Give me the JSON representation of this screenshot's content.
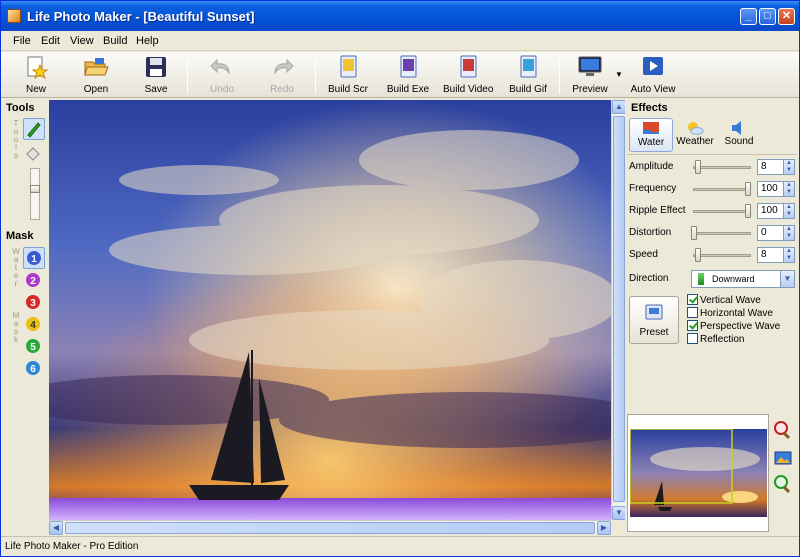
{
  "window": {
    "title": "Life Photo Maker - [Beautiful Sunset]"
  },
  "menu": [
    "File",
    "Edit",
    "View",
    "Build",
    "Help"
  ],
  "toolbar": {
    "new": "New",
    "open": "Open",
    "save": "Save",
    "undo": "Undo",
    "redo": "Redo",
    "build_scr": "Build Scr",
    "build_exe": "Build Exe",
    "build_video": "Build Video",
    "build_gif": "Build Gif",
    "preview": "Preview",
    "auto_view": "Auto View"
  },
  "left_panel": {
    "tools_header": "Tools",
    "tools_vertical": "Tools",
    "mask_header": "Mask",
    "water_vertical": "Water",
    "mask_vertical": "Mask",
    "mask_numbers": [
      "1",
      "2",
      "3",
      "4",
      "5",
      "6"
    ]
  },
  "effects": {
    "header": "Effects",
    "tabs": [
      "Water",
      "Weather",
      "Sound"
    ],
    "active_tab": "Water",
    "properties": {
      "amplitude": {
        "label": "Amplitude",
        "value": "8"
      },
      "frequency": {
        "label": "Frequency",
        "value": "100"
      },
      "ripple": {
        "label": "Ripple Effect",
        "value": "100"
      },
      "distortion": {
        "label": "Distortion",
        "value": "0"
      },
      "speed": {
        "label": "Speed",
        "value": "8"
      }
    },
    "direction": {
      "label": "Direction",
      "value": "Downward"
    },
    "preset_label": "Preset",
    "checkboxes": {
      "vertical_wave": {
        "label": "Vertical Wave",
        "checked": true
      },
      "horizontal_wave": {
        "label": "Horizontal Wave",
        "checked": false
      },
      "perspective_wave": {
        "label": "Perspective Wave",
        "checked": true
      },
      "reflection": {
        "label": "Reflection",
        "checked": false
      }
    }
  },
  "status": {
    "text": "Life Photo Maker - Pro Edition"
  }
}
